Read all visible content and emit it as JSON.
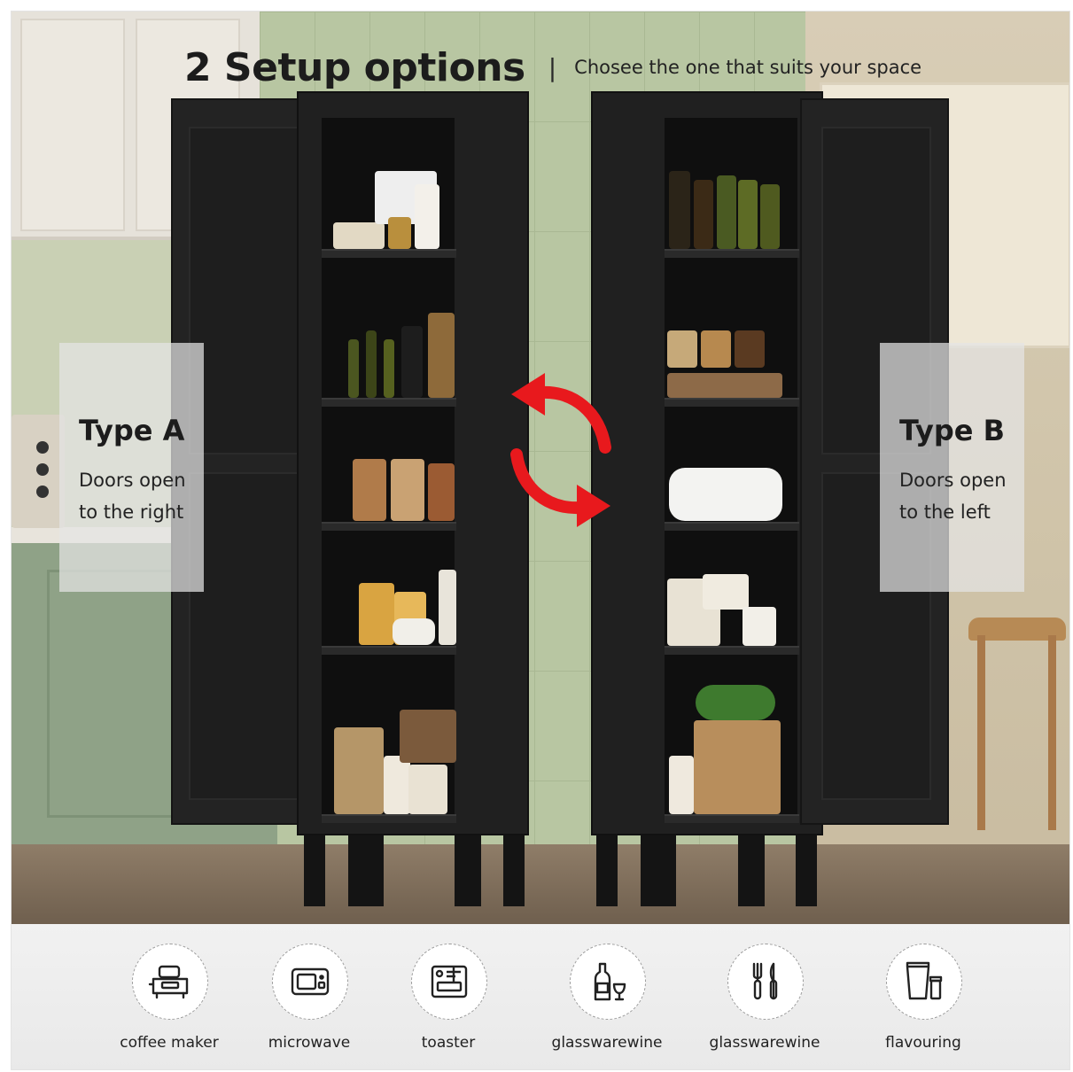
{
  "headline": {
    "title": "2 Setup options",
    "separator": "|",
    "subtitle": "Chosee the one that suits your space"
  },
  "type_a": {
    "title": "Type A",
    "line1": "Doors open",
    "line2": "to the right"
  },
  "type_b": {
    "title": "Type B",
    "line1": "Doors open",
    "line2": "to the left"
  },
  "swap_arrows": {
    "color": "#e8191d",
    "icon": "swap-arrows-icon"
  },
  "features": [
    {
      "label": "coffee maker",
      "icon": "coffee-maker-icon"
    },
    {
      "label": "microwave",
      "icon": "microwave-icon"
    },
    {
      "label": "toaster",
      "icon": "toaster-icon"
    },
    {
      "label": "glasswarewine",
      "icon": "wine-glass-icon"
    },
    {
      "label": "glasswarewine",
      "icon": "cutlery-icon"
    },
    {
      "label": "flavouring",
      "icon": "condiment-icon"
    }
  ]
}
